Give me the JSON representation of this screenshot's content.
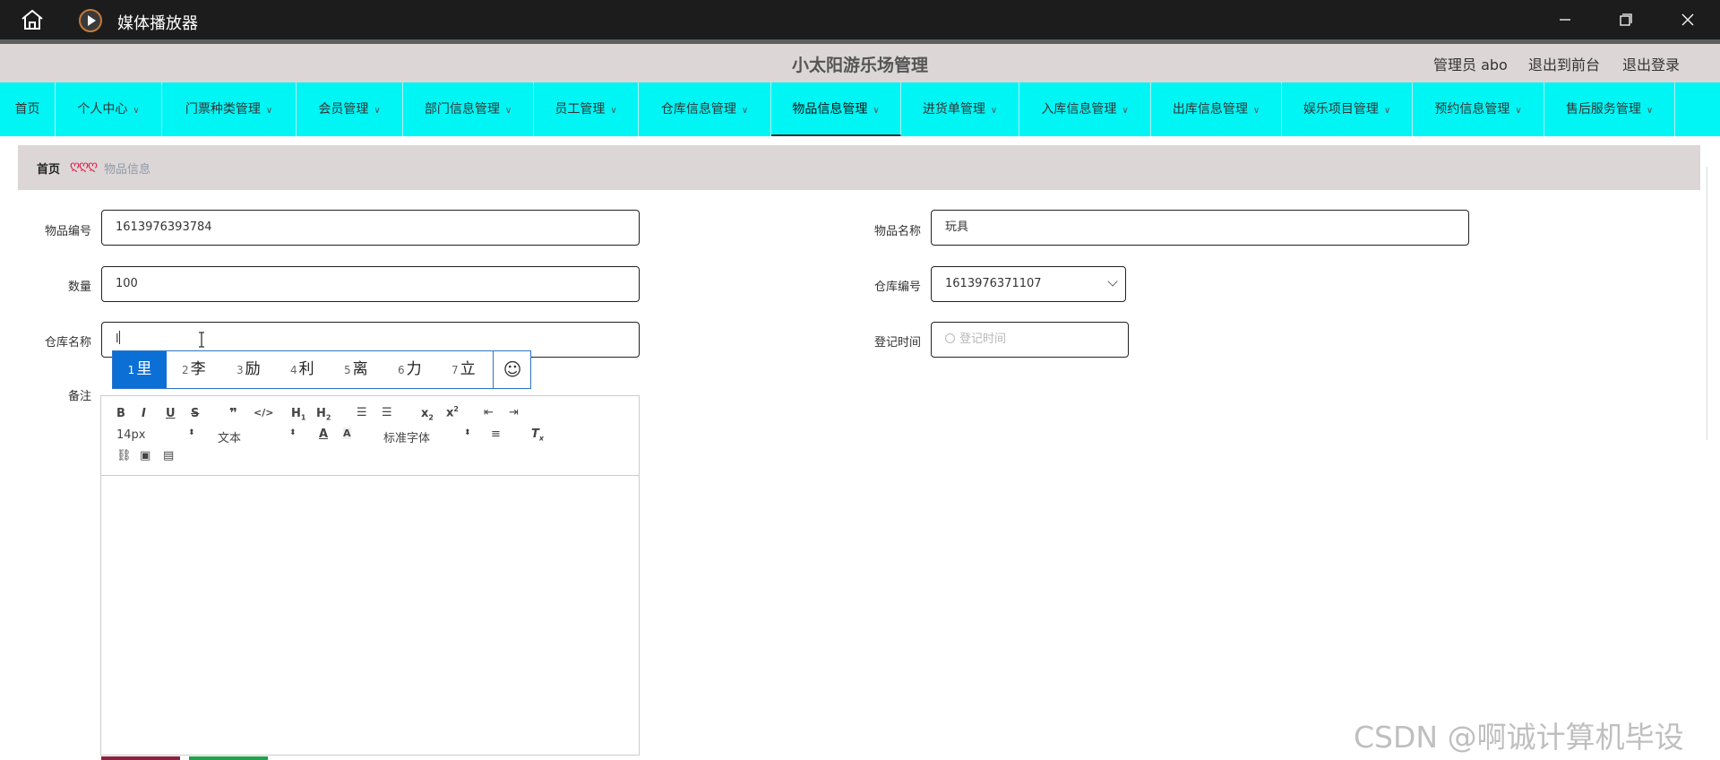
{
  "window": {
    "title": "媒体播放器"
  },
  "header": {
    "site_title": "小太阳游乐场管理",
    "admin_label": "管理员 abo",
    "link_front": "退出到前台",
    "link_logout": "退出登录"
  },
  "menu": [
    {
      "label": "首页"
    },
    {
      "label": "个人中心"
    },
    {
      "label": "门票种类管理"
    },
    {
      "label": "会员管理"
    },
    {
      "label": "部门信息管理"
    },
    {
      "label": "员工管理"
    },
    {
      "label": "仓库信息管理"
    },
    {
      "label": "物品信息管理"
    },
    {
      "label": "进货单管理"
    },
    {
      "label": "入库信息管理"
    },
    {
      "label": "出库信息管理"
    },
    {
      "label": "娱乐项目管理"
    },
    {
      "label": "预约信息管理"
    },
    {
      "label": "售后服务管理"
    }
  ],
  "breadcrumb": {
    "home": "首页",
    "separator": "ღღღ",
    "current": "物品信息"
  },
  "form": {
    "item_no_label": "物品编号",
    "item_no_value": "1613976393784",
    "item_name_label": "物品名称",
    "item_name_value": "玩具",
    "quantity_label": "数量",
    "quantity_value": "100",
    "warehouse_no_label": "仓库编号",
    "warehouse_no_value": "1613976371107",
    "warehouse_name_label": "仓库名称",
    "warehouse_name_value": "l",
    "register_time_label": "登记时间",
    "register_time_placeholder": "登记时间",
    "notes_label": "备注"
  },
  "ime": {
    "candidates": [
      {
        "n": "1",
        "c": "里"
      },
      {
        "n": "2",
        "c": "李"
      },
      {
        "n": "3",
        "c": "励"
      },
      {
        "n": "4",
        "c": "利"
      },
      {
        "n": "5",
        "c": "离"
      },
      {
        "n": "6",
        "c": "力"
      },
      {
        "n": "7",
        "c": "立"
      }
    ],
    "emoji": "☺"
  },
  "editor": {
    "font_size": "14px",
    "block_type": "文本",
    "font_family": "标准字体"
  },
  "watermark": "CSDN @啊诚计算机毕设"
}
